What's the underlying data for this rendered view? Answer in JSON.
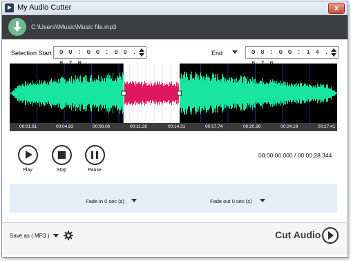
{
  "window": {
    "title": "My Audio Cutter",
    "close": "x"
  },
  "pathbar": {
    "path": "C:\\Users\\\\Music\\Music file.mp3"
  },
  "selection": {
    "start_label": "Selection Start",
    "start_value": "0 0 : 0 0 : 0 9 . 8 7 8",
    "end_label": "End",
    "end_value": "0 0 : 0 0 : 1 4 . 6 7 6"
  },
  "timeline": {
    "ticks": [
      "00:01.61",
      "00:04.83",
      "00:08.06",
      "00:11.28",
      "00:14.51",
      "00:17.74",
      "00:20.96",
      "00:24.19",
      "00:27.41"
    ]
  },
  "waveform": {
    "total_seconds": 28.344,
    "selection_start_seconds": 9.878,
    "selection_end_seconds": 14.676,
    "colors": {
      "background": "#000000",
      "wave": "#18e6a0",
      "selected_wave": "#e0185e",
      "selection_bg": "#ffffff",
      "grid": "#1e2e8a"
    }
  },
  "controls": {
    "play": "Play",
    "stop": "Stop",
    "pause": "Pause"
  },
  "duration": "00:00:00.000 / 00:00:28.344",
  "fade": {
    "fade_in": "Fade in 0 sec (s)",
    "fade_out": "Fade out 0 sec (s)"
  },
  "footer": {
    "save_as": "Save as ( MP3 )",
    "cut": "Cut Audio"
  }
}
